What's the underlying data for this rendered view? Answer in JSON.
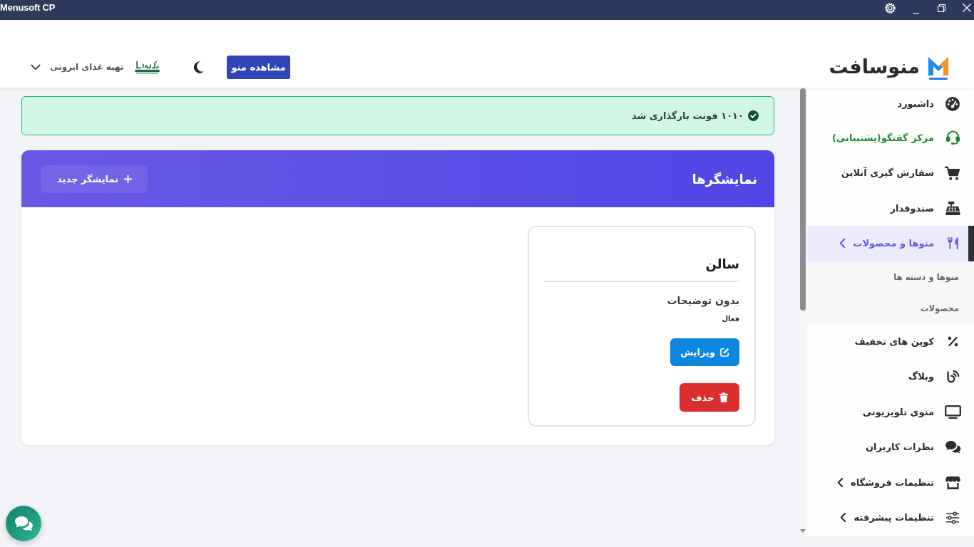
{
  "window": {
    "title": "Menusoft CP"
  },
  "header": {
    "brand": "منوسافت",
    "view_menu_button": "مشاهده منو",
    "restaurant_selector": "تهیه غذای ایرونی"
  },
  "alert": {
    "message": "۱۰۱۰ فونت بارگذاری شد"
  },
  "panel": {
    "title": "نمایشگرها",
    "new_button": "نمایشگر جدید",
    "cards": [
      {
        "title": "سالن",
        "description": "بدون توضیحات",
        "status": "فعال",
        "edit_button": "ویرایش",
        "delete_button": "حذف"
      }
    ]
  },
  "sidebar": {
    "items": [
      {
        "label": "داشبورد",
        "kind": "link",
        "selected": false
      },
      {
        "label": "مرکز گفتگو(پشتیبانی)",
        "kind": "link",
        "selected": false,
        "color": "#1e8a2e"
      },
      {
        "label": "سفارش گیری آنلاین",
        "kind": "link",
        "selected": false
      },
      {
        "label": "صندوقدار",
        "kind": "link",
        "selected": false
      },
      {
        "label": "منوها و محصولات",
        "kind": "group",
        "selected": true,
        "children": [
          {
            "label": "منوها و دسته ها",
            "selected": false
          },
          {
            "label": "محصولات",
            "selected": false
          }
        ]
      },
      {
        "label": "کوپن های تخفیف",
        "kind": "link",
        "selected": false
      },
      {
        "label": "وبلاگ",
        "kind": "link",
        "selected": false
      },
      {
        "label": "منوی تلویزیونی",
        "kind": "link",
        "selected": false
      },
      {
        "label": "نظرات کاربران",
        "kind": "link",
        "selected": false
      },
      {
        "label": "تنظیمات فروشگاه",
        "kind": "group",
        "selected": false
      },
      {
        "label": "تنظیمات پیشرفته",
        "kind": "group",
        "selected": false
      }
    ]
  }
}
